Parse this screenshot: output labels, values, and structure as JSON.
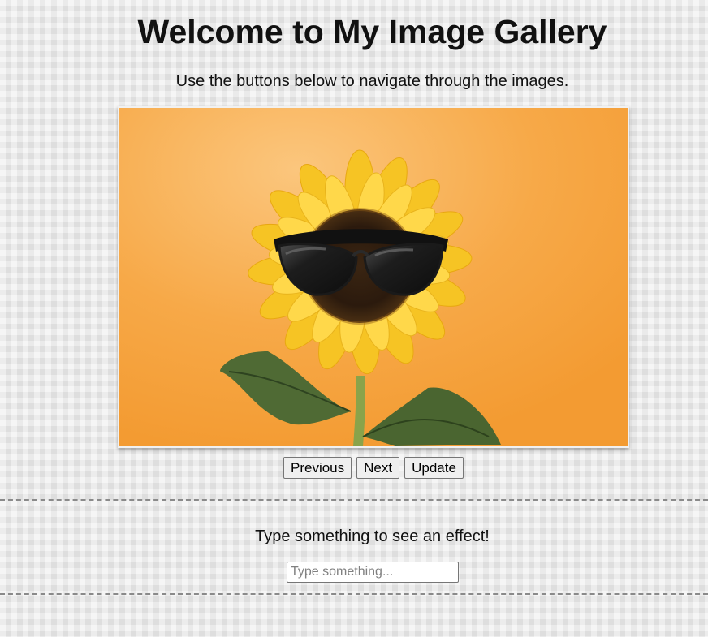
{
  "header": {
    "title": "Welcome to My Image Gallery",
    "subtitle": "Use the buttons below to navigate through the images."
  },
  "gallery": {
    "image_alt": "Sunflower wearing sunglasses",
    "buttons": {
      "previous": "Previous",
      "next": "Next",
      "update": "Update"
    }
  },
  "effect": {
    "prompt": "Type something to see an effect!",
    "placeholder": "Type something..."
  },
  "colors": {
    "background": "#e9e9e9",
    "image_background": "#f7a63c",
    "divider": "#8a8a8a"
  }
}
